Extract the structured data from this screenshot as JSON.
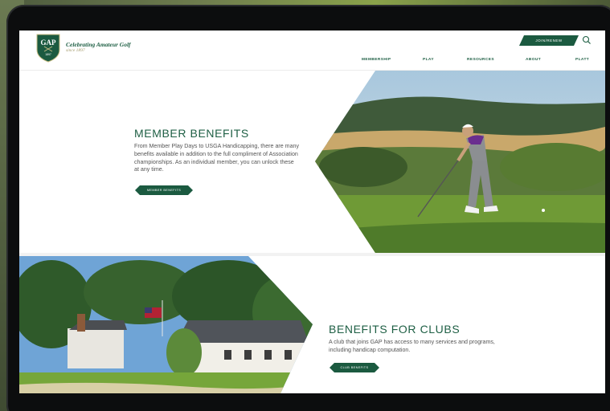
{
  "header": {
    "logo_text": "GAP",
    "logo_year": "1897",
    "tagline": "Celebrating Amateur Golf",
    "since": "since 1897",
    "join_label": "JOIN/RENEW",
    "nav": [
      "MEMBERSHIP",
      "PLAY",
      "RESOURCES",
      "ABOUT",
      "PLATT"
    ]
  },
  "member_section": {
    "title": "MEMBER BENEFITS",
    "body": "From Member Play Days to USGA Handicapping, there are many benefits available in addition to the full compliment of Association championships. As an individual member, you can unlock these at any time.",
    "button": "MEMBER BENEFITS"
  },
  "club_section": {
    "title": "BENEFITS FOR CLUBS",
    "body": "A club that joins GAP has access to many services and programs, including handicap computation.",
    "button": "CLUB BENEFITS"
  },
  "colors": {
    "brand_green": "#1b5a40",
    "accent_gold": "#a39a6a"
  }
}
